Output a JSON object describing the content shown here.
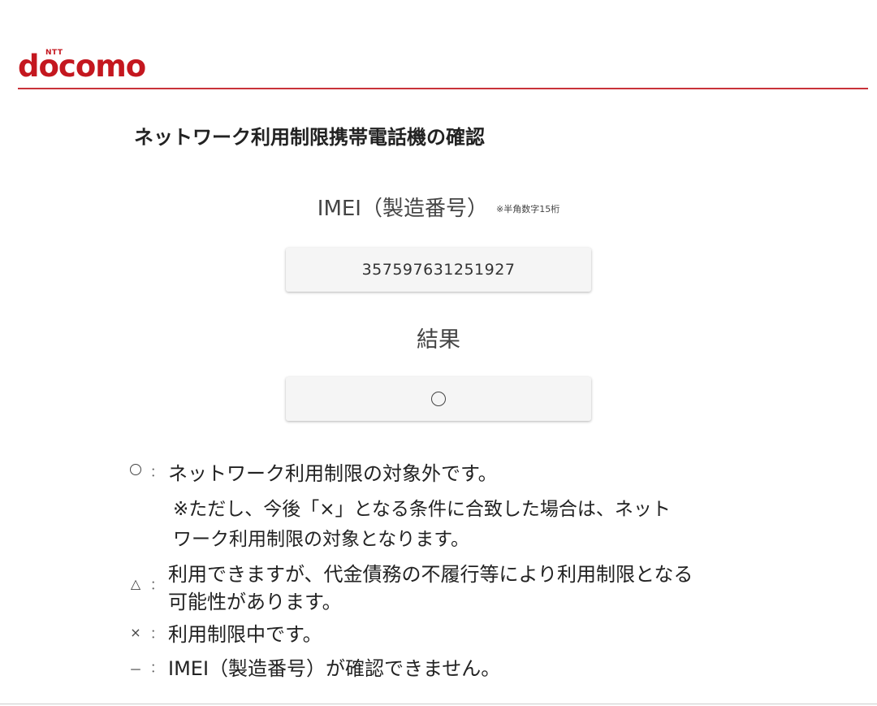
{
  "header": {
    "brand_small": "NTT",
    "brand": "docomo"
  },
  "page_title": "ネットワーク利用制限携帯電話機の確認",
  "imei": {
    "label": "IMEI（製造番号）",
    "note": "※半角数字15桁",
    "value": "357597631251927"
  },
  "result": {
    "label": "結果",
    "value_icon": "circle-icon"
  },
  "legend": [
    {
      "symbol": "○",
      "colon": "：",
      "text": "ネットワーク利用制限の対象外です。",
      "note_line1": "※ただし、今後「×」となる条件に合致した場合は、ネット",
      "note_line2": "ワーク利用制限の対象となります。"
    },
    {
      "symbol": "△",
      "colon": "：",
      "text_line1": "利用できますが、代金債務の不履行等により利用制限となる",
      "text_line2": "可能性があります。"
    },
    {
      "symbol": "×",
      "colon": "：",
      "text": "利用制限中です。"
    },
    {
      "symbol": "－",
      "colon": "：",
      "text": "IMEI（製造番号）が確認できません。"
    }
  ],
  "colors": {
    "brand": "#c4171f",
    "header_line": "#c9323a",
    "box_background": "#f5f5f5"
  }
}
